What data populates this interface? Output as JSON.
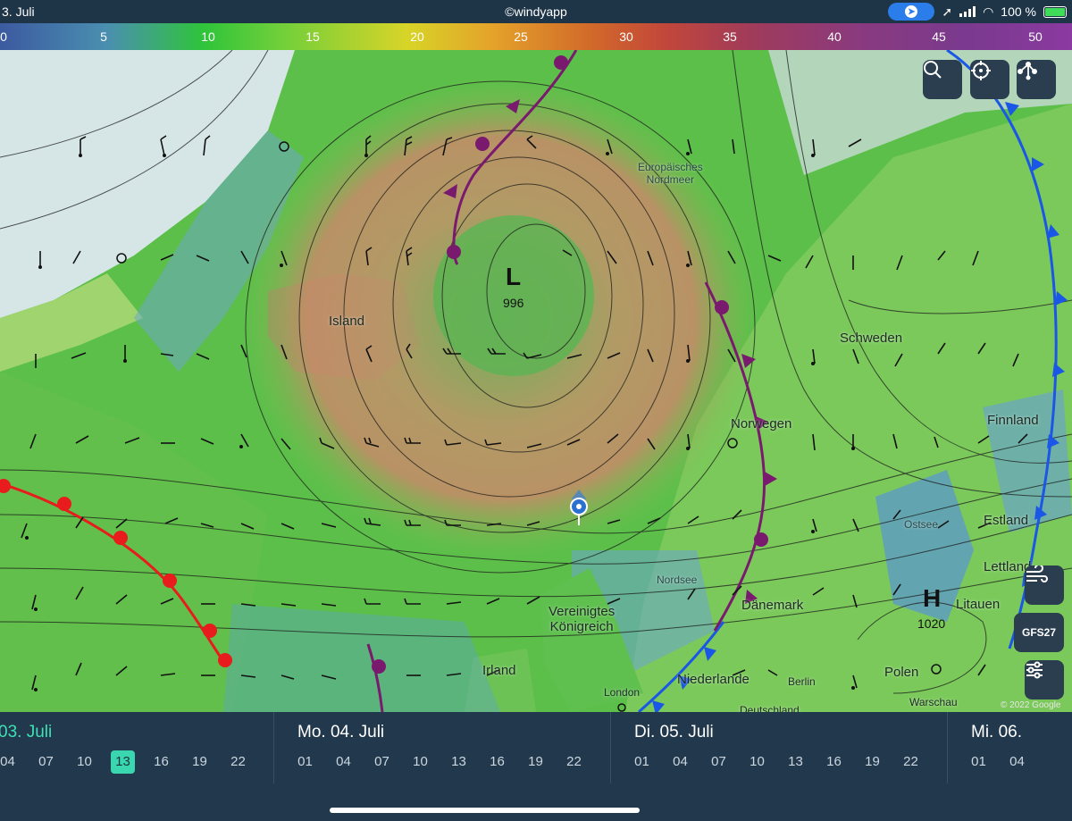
{
  "status_bar": {
    "date": "3. Juli",
    "center": "©windyapp",
    "battery": "100 %",
    "battery_level": 1.0
  },
  "scale": {
    "labels": [
      "0",
      "5",
      "10",
      "15",
      "20",
      "25",
      "30",
      "35",
      "40",
      "45",
      "50"
    ]
  },
  "map": {
    "low": {
      "letter": "L",
      "pressure": "996"
    },
    "high": {
      "letter": "H",
      "pressure": "1020"
    },
    "labels": {
      "nordmeer": "Europäisches\nNordmeer",
      "island": "Island",
      "schweden": "Schweden",
      "norwegen": "Norwegen",
      "finnland": "Finnland",
      "ostsee": "Ostsee",
      "estland": "Estland",
      "lettland": "Lettland",
      "litauen": "Litauen",
      "nordsee": "Nordsee",
      "daenemark": "Dänemark",
      "uk": "Vereinigtes\nKönigreich",
      "irland": "Irland",
      "niederlande": "Niederlande",
      "london": "London",
      "berlin": "Berlin",
      "polen": "Polen",
      "warschau": "Warschau",
      "deutschland": "Deutschland",
      "copyright": "© 2022 Google"
    },
    "buttons": {
      "model": "GFS27"
    },
    "colors": {
      "cold_front": "#1a57e6",
      "warm_front": "#e81c1c",
      "occluded_front": "#7a1a6e",
      "isobar": "#1a1a1a"
    }
  },
  "timeline": {
    "days": [
      {
        "title": "03. Juli",
        "hours": [
          "04",
          "07",
          "10",
          "13",
          "16",
          "19",
          "22"
        ],
        "selected": "13"
      },
      {
        "title": "Mo. 04. Juli",
        "hours": [
          "01",
          "04",
          "07",
          "10",
          "13",
          "16",
          "19",
          "22"
        ]
      },
      {
        "title": "Di. 05. Juli",
        "hours": [
          "01",
          "04",
          "07",
          "10",
          "13",
          "16",
          "19",
          "22"
        ]
      },
      {
        "title": "Mi. 06.",
        "hours": [
          "01",
          "04"
        ]
      }
    ]
  }
}
